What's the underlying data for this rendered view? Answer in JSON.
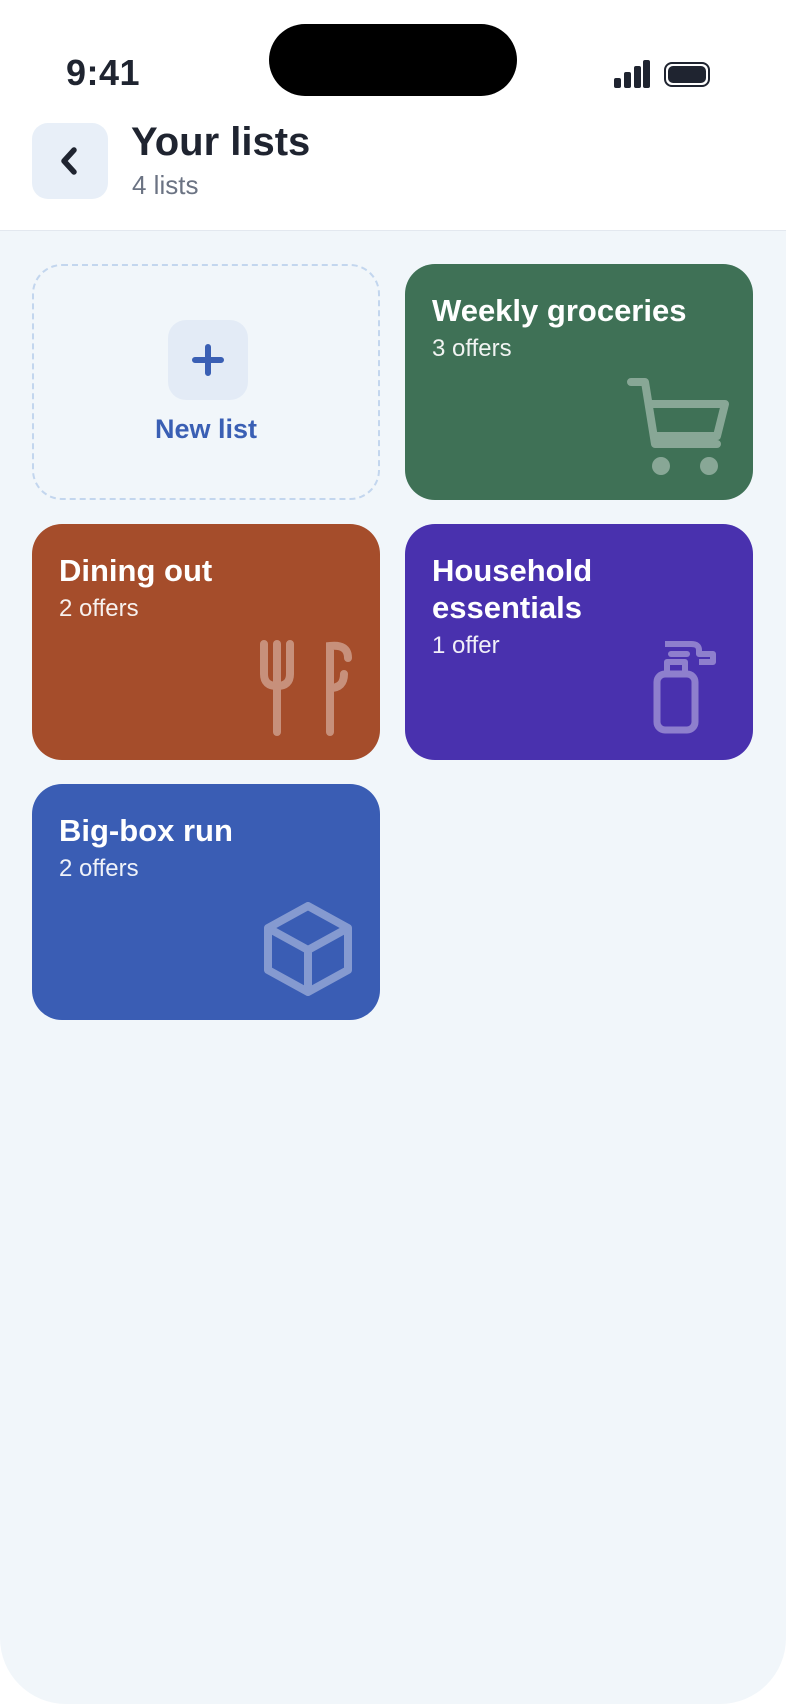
{
  "status_bar": {
    "time": "9:41"
  },
  "header": {
    "title": "Your lists",
    "subtitle": "4 lists"
  },
  "new_list": {
    "label": "New list"
  },
  "lists": [
    {
      "name": "Weekly groceries",
      "count": "3 offers",
      "color": "#3f7156",
      "icon": "cart-icon"
    },
    {
      "name": "Dining out",
      "count": "2 offers",
      "color": "#a54d2b",
      "icon": "fork-knife-icon"
    },
    {
      "name": "Household essentials",
      "count": "1 offer",
      "color": "#4931ae",
      "icon": "spray-bottle-icon"
    },
    {
      "name": "Big-box run",
      "count": "2 offers",
      "color": "#3a5db4",
      "icon": "box-icon"
    }
  ]
}
